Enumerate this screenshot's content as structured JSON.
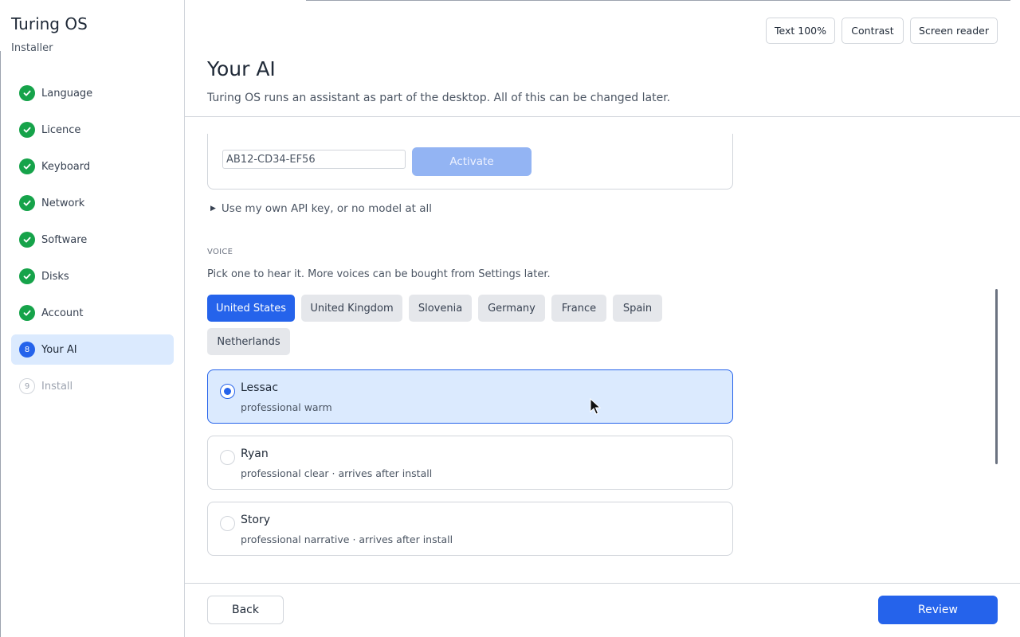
{
  "sidebar": {
    "brand": "Turing OS",
    "subtitle": "Installer",
    "steps": [
      {
        "label": "Language",
        "state": "done"
      },
      {
        "label": "Licence",
        "state": "done"
      },
      {
        "label": "Keyboard",
        "state": "done"
      },
      {
        "label": "Network",
        "state": "done"
      },
      {
        "label": "Software",
        "state": "done"
      },
      {
        "label": "Disks",
        "state": "done"
      },
      {
        "label": "Account",
        "state": "done"
      },
      {
        "label": "Your AI",
        "state": "active",
        "number": "8"
      },
      {
        "label": "Install",
        "state": "pending",
        "number": "9"
      }
    ]
  },
  "accessibility": {
    "text_size": "Text 100%",
    "contrast": "Contrast",
    "screen_reader": "Screen reader"
  },
  "header": {
    "title": "Your AI",
    "subtitle": "Turing OS runs an assistant as part of the desktop. All of this can be changed later."
  },
  "licence": {
    "code_value": "AB12-CD34-EF56",
    "activate_label": "Activate",
    "own_key_label": "Use my own API key, or no model at all"
  },
  "voice": {
    "section_label": "VOICE",
    "description": "Pick one to hear it. More voices can be bought from Settings later.",
    "regions": [
      "United States",
      "United Kingdom",
      "Slovenia",
      "Germany",
      "France",
      "Spain",
      "Netherlands"
    ],
    "selected_region": "United States",
    "options": [
      {
        "name": "Lessac",
        "description": "professional warm",
        "selected": true
      },
      {
        "name": "Ryan",
        "description": "professional clear · arrives after install",
        "selected": false
      },
      {
        "name": "Story",
        "description": "professional narrative · arrives after install",
        "selected": false
      }
    ]
  },
  "footer": {
    "back_label": "Back",
    "review_label": "Review"
  },
  "colors": {
    "accent": "#2563eb",
    "done": "#16a34a",
    "selected_bg": "#dbeafe"
  }
}
